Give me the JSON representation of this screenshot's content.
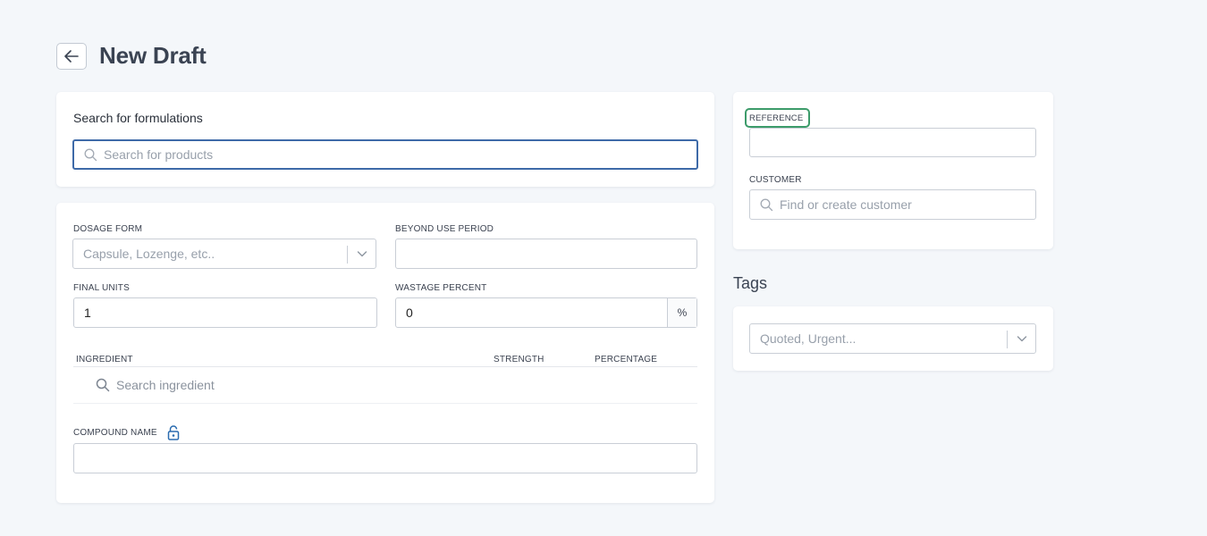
{
  "header": {
    "title": "New Draft",
    "back_icon": "arrow-left-icon"
  },
  "search_card": {
    "label": "Search for formulations",
    "placeholder": "Search for products"
  },
  "form": {
    "dosage_form": {
      "label": "DOSAGE FORM",
      "placeholder": "Capsule, Lozenge, etc.."
    },
    "beyond_use": {
      "label": "BEYOND USE PERIOD",
      "value": ""
    },
    "final_units": {
      "label": "FINAL UNITS",
      "value": "1"
    },
    "wastage": {
      "label": "WASTAGE PERCENT",
      "value": "0",
      "suffix": "%"
    },
    "ingredients": {
      "columns": [
        "INGREDIENT",
        "STRENGTH",
        "PERCENTAGE"
      ],
      "search_placeholder": "Search ingredient"
    },
    "compound_name": {
      "label": "COMPOUND NAME",
      "value": "",
      "icon": "lock-open-icon"
    }
  },
  "side": {
    "reference": {
      "label": "REFERENCE",
      "value": ""
    },
    "customer": {
      "label": "CUSTOMER",
      "placeholder": "Find or create customer"
    }
  },
  "tags": {
    "title": "Tags",
    "placeholder": "Quoted, Urgent..."
  },
  "colors": {
    "focus": "#3e6aa8",
    "highlight": "#3c9b6a",
    "lock_icon": "#2b6cb0"
  }
}
